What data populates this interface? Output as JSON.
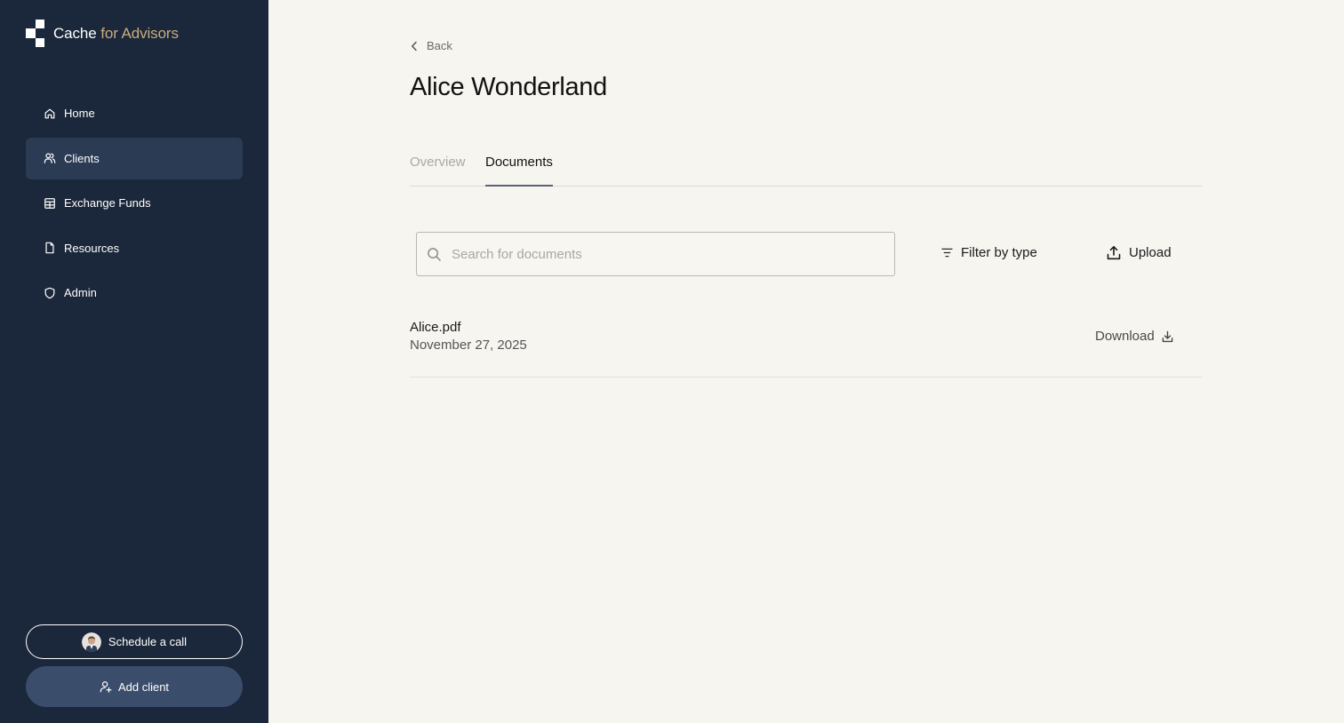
{
  "sidebar": {
    "logo": {
      "name": "Cache",
      "suffix": "for Advisors"
    },
    "items": [
      {
        "label": "Home",
        "icon": "home-icon",
        "active": false
      },
      {
        "label": "Clients",
        "icon": "users-icon",
        "active": true
      },
      {
        "label": "Exchange Funds",
        "icon": "grid-icon",
        "active": false
      },
      {
        "label": "Resources",
        "icon": "file-icon",
        "active": false
      },
      {
        "label": "Admin",
        "icon": "shield-icon",
        "active": false
      }
    ],
    "schedule_label": "Schedule a call",
    "add_client_label": "Add client"
  },
  "main": {
    "back_label": "Back",
    "title": "Alice Wonderland",
    "tabs": [
      {
        "label": "Overview",
        "active": false
      },
      {
        "label": "Documents",
        "active": true
      }
    ],
    "search": {
      "placeholder": "Search for documents",
      "value": ""
    },
    "filter_label": "Filter by type",
    "upload_label": "Upload",
    "documents": [
      {
        "name": "Alice.pdf",
        "date": "November 27, 2025",
        "action": "Download"
      }
    ]
  },
  "colors": {
    "sidebar_bg": "#1b273a",
    "sidebar_active": "#2b3b53",
    "accent_gold": "#c9ad7e",
    "page_bg": "#f6f5f0",
    "add_button_bg": "#3a4d6b"
  }
}
